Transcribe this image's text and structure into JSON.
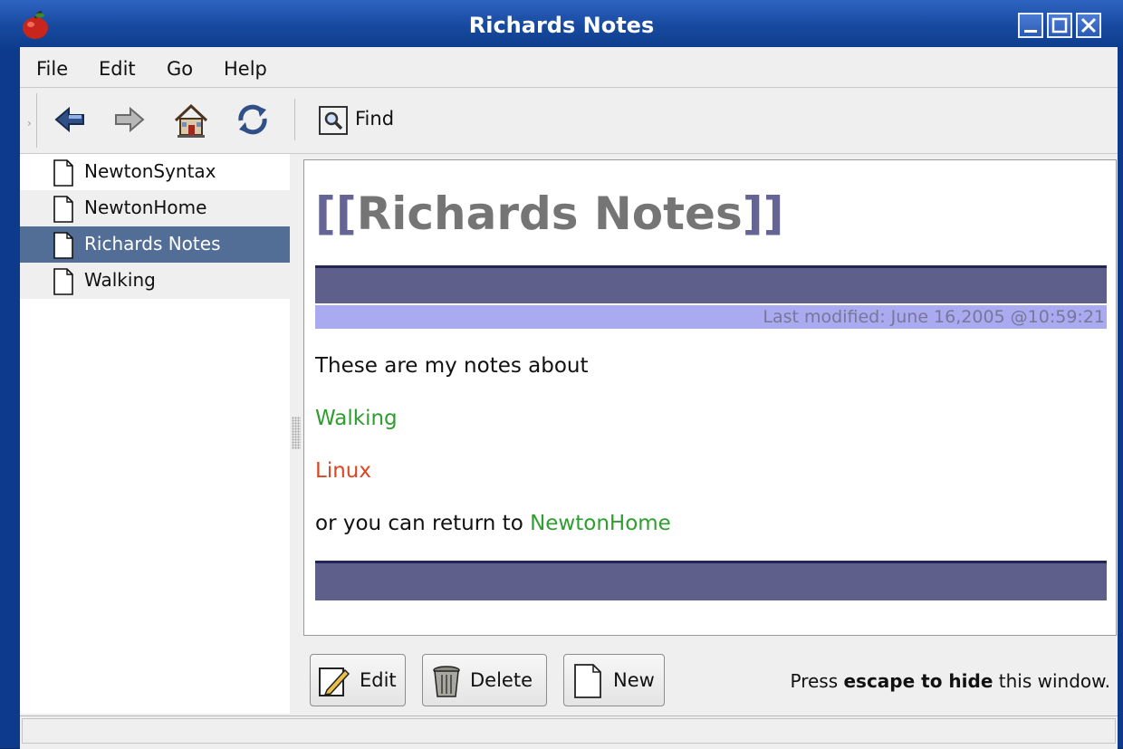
{
  "window": {
    "title": "Richards Notes",
    "controls": [
      "minimize-icon",
      "maximize-icon",
      "close-icon"
    ]
  },
  "menu": {
    "items": [
      {
        "label": "File"
      },
      {
        "label": "Edit"
      },
      {
        "label": "Go"
      },
      {
        "label": "Help"
      }
    ]
  },
  "toolbar": {
    "buttons": [
      {
        "name": "back",
        "icon": "arrow-left-icon"
      },
      {
        "name": "forward",
        "icon": "arrow-right-icon"
      },
      {
        "name": "home",
        "icon": "home-icon"
      },
      {
        "name": "refresh",
        "icon": "refresh-icon"
      }
    ],
    "find_label": "Find"
  },
  "sidebar": {
    "items": [
      {
        "label": "NewtonSyntax",
        "selected": false
      },
      {
        "label": "NewtonHome",
        "selected": false
      },
      {
        "label": "Richards Notes",
        "selected": true
      },
      {
        "label": "Walking",
        "selected": false
      }
    ]
  },
  "content": {
    "title_open": "[[",
    "title": "Richards Notes",
    "title_close": "]]",
    "last_modified": "Last modified: June 16,2005 @10:59:21",
    "line1": "These are my notes about",
    "link_walking": "Walking",
    "link_linux": "Linux",
    "line4_prefix": "or you can return to ",
    "link_home": "NewtonHome"
  },
  "buttons": {
    "edit": "Edit",
    "delete": "Delete",
    "new": "New"
  },
  "hint": {
    "prefix": "Press ",
    "bold": "escape to hide",
    "suffix": " this window."
  },
  "colors": {
    "title_gradient": "#174a9f",
    "selection": "#536e96",
    "band": "#5f5f8c",
    "modified_bar": "#aaaaf0",
    "link_existing": "#2e9e2e",
    "link_missing": "#dd4422"
  }
}
